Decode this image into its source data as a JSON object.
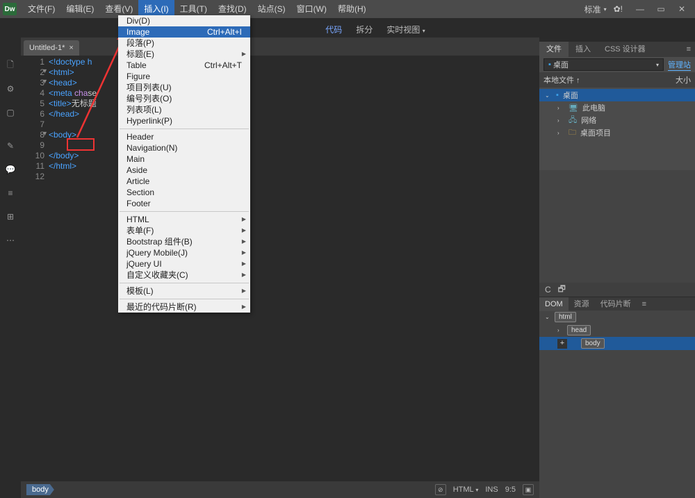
{
  "app_icon": "Dw",
  "menu": [
    "文件(F)",
    "编辑(E)",
    "查看(V)",
    "插入(I)",
    "工具(T)",
    "查找(D)",
    "站点(S)",
    "窗口(W)",
    "帮助(H)"
  ],
  "menu_active_index": 3,
  "layout_label": "标准",
  "gear_alert": "!",
  "viewtabs": {
    "code": "代码",
    "split": "拆分",
    "live": "实时视图"
  },
  "doc_tab": "Untitled-1*",
  "code_lines": [
    {
      "n": "1",
      "html": "<span class='tag'>&lt;!doctype h</span>"
    },
    {
      "n": "2",
      "html": "<span class='tag'>&lt;html&gt;</span>",
      "fold": true
    },
    {
      "n": "3",
      "html": "<span class='tag'>&lt;head&gt;</span>",
      "fold": true
    },
    {
      "n": "4",
      "html": "<span class='tag'>&lt;meta</span> <span class='attr'>cha</span>se"
    },
    {
      "n": "5",
      "html": "<span class='tag'>&lt;title&gt;</span><span class='txt'>无标题</span>"
    },
    {
      "n": "6",
      "html": "<span class='tag'>&lt;/head&gt;</span>"
    },
    {
      "n": "7",
      "html": ""
    },
    {
      "n": "8",
      "html": "<span class='tag'>&lt;body&gt;</span>",
      "fold": true
    },
    {
      "n": "9",
      "html": ""
    },
    {
      "n": "10",
      "html": "<span class='tag'>&lt;/body&gt;</span>"
    },
    {
      "n": "11",
      "html": "<span class='tag'>&lt;/html&gt;</span>"
    },
    {
      "n": "12",
      "html": ""
    }
  ],
  "insert_menu": [
    {
      "items": [
        {
          "l": "Div(D)"
        },
        {
          "l": "Image",
          "s": "Ctrl+Alt+I",
          "hl": true
        },
        {
          "l": "段落(P)"
        },
        {
          "l": "标题(E)",
          "sub": true
        },
        {
          "l": "Table",
          "s": "Ctrl+Alt+T"
        },
        {
          "l": "Figure"
        },
        {
          "l": "项目列表(U)"
        },
        {
          "l": "编号列表(O)"
        },
        {
          "l": "列表项(L)"
        },
        {
          "l": "Hyperlink(P)"
        }
      ]
    },
    {
      "items": [
        {
          "l": "Header"
        },
        {
          "l": "Navigation(N)"
        },
        {
          "l": "Main"
        },
        {
          "l": "Aside"
        },
        {
          "l": "Article"
        },
        {
          "l": "Section"
        },
        {
          "l": "Footer"
        }
      ]
    },
    {
      "items": [
        {
          "l": "HTML",
          "sub": true
        },
        {
          "l": "表单(F)",
          "sub": true
        },
        {
          "l": "Bootstrap 组件(B)",
          "sub": true
        },
        {
          "l": "jQuery Mobile(J)",
          "sub": true
        },
        {
          "l": "jQuery UI",
          "sub": true
        },
        {
          "l": "自定义收藏夹(C)",
          "sub": true
        }
      ]
    },
    {
      "items": [
        {
          "l": "模板(L)",
          "sub": true
        }
      ]
    },
    {
      "items": [
        {
          "l": "最近的代码片断(R)",
          "sub": true
        }
      ]
    }
  ],
  "right": {
    "tabs": [
      "文件",
      "插入",
      "CSS 设计器"
    ],
    "desktop": "桌面",
    "manage": "管理站",
    "local": "本地文件 ↑",
    "size": "大小",
    "tree": [
      {
        "indent": 0,
        "icon": "desktop",
        "label": "桌面",
        "sel": true,
        "exp": true
      },
      {
        "indent": 1,
        "icon": "pc",
        "label": "此电脑"
      },
      {
        "indent": 1,
        "icon": "net",
        "label": "网络"
      },
      {
        "indent": 1,
        "icon": "folder",
        "label": "桌面项目"
      }
    ],
    "dom_tabs": [
      "DOM",
      "资源",
      "代码片断"
    ],
    "dom": [
      {
        "indent": 0,
        "tag": "html",
        "exp": true
      },
      {
        "indent": 1,
        "tag": "head",
        "child": true
      },
      {
        "indent": 1,
        "tag": "body",
        "sel": true,
        "plus": true
      }
    ]
  },
  "status": {
    "crumb": "body",
    "err": "⊘",
    "html": "HTML",
    "ins": "INS",
    "pos": "9:5"
  }
}
